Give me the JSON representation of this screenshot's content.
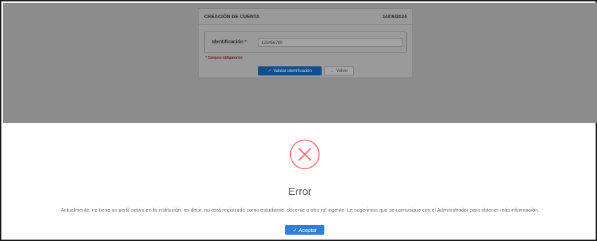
{
  "form": {
    "title": "CREACIÓN DE CUENTA",
    "date": "14/09/2024",
    "id_label": "Identificación",
    "required_mark": "*",
    "id_value": "123456789",
    "required_note": "* Campos obligatorios",
    "validate_label": "Validar identificación",
    "back_label": "Volver"
  },
  "dialog": {
    "icon": "error-x-circle-icon",
    "title": "Error",
    "message": "Actualmente, no tiene un perfil activo en la institución, es decir, no está registrado como estudiante, docente u otro rol vigente. Le sugerimos que se comunique con el Administrador para obtener más información.",
    "accept_label": "Aceptar"
  },
  "colors": {
    "primary_button": "#2f7ed8",
    "error_red": "#f27474",
    "required_red": "#7a1212"
  }
}
